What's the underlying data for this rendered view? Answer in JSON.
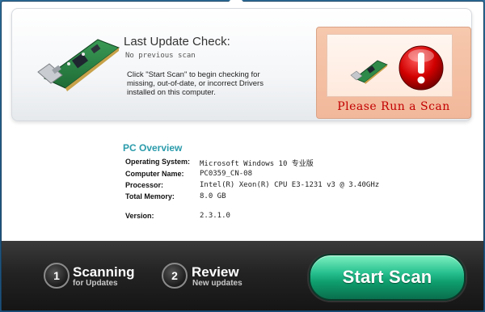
{
  "update": {
    "title": "Last Update Check:",
    "subtitle": "No previous scan",
    "description": "Click \"Start Scan\" to begin checking for missing, out-of-date, or incorrect Drivers installed on this computer."
  },
  "alert": {
    "message": "Please Run a Scan",
    "accent_color": "#c20000"
  },
  "overview": {
    "title": "PC Overview",
    "rows": [
      {
        "label": "Operating System:",
        "value": "Microsoft Windows 10 专业版"
      },
      {
        "label": "Computer Name:",
        "value": "PC0359_CN-08"
      },
      {
        "label": "Processor:",
        "value": "Intel(R) Xeon(R) CPU E3-1231 v3 @ 3.40GHz"
      },
      {
        "label": "Total Memory:",
        "value": "8.0 GB"
      },
      {
        "label": "Version:",
        "value": "2.3.1.0"
      }
    ]
  },
  "steps": [
    {
      "number": "1",
      "title": "Scanning",
      "subtitle": "for Updates"
    },
    {
      "number": "2",
      "title": "Review",
      "subtitle": "New updates"
    }
  ],
  "start_button": {
    "label": "Start Scan",
    "color": "#1aa878"
  },
  "icons": {
    "header_card": "network-card-icon",
    "alert_card": "network-card-icon",
    "alert_symbol": "warning-exclamation-icon"
  }
}
